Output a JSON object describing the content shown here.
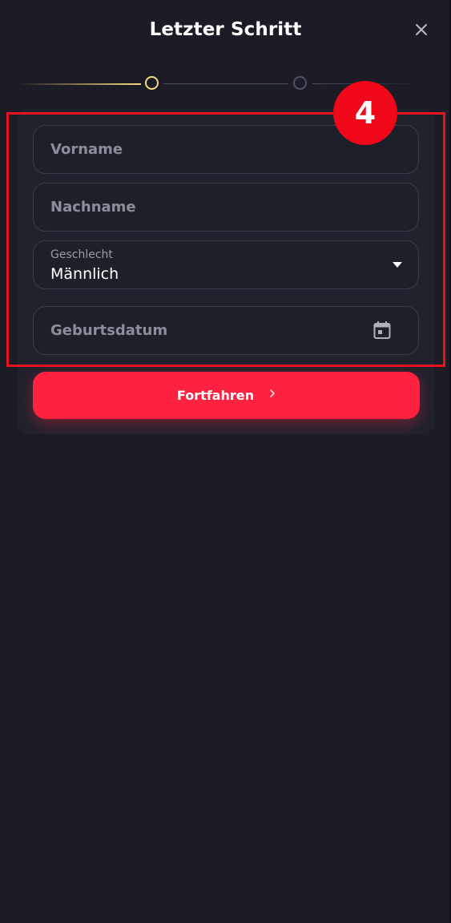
{
  "header": {
    "title": "Letzter Schritt",
    "close_icon": "close-icon"
  },
  "stepper": {
    "current_step": 1,
    "total_steps": 2,
    "active_color": "#f5d97e"
  },
  "form": {
    "first_name": {
      "placeholder": "Vorname",
      "value": ""
    },
    "last_name": {
      "placeholder": "Nachname",
      "value": ""
    },
    "gender": {
      "label": "Geschlecht",
      "value": "Männlich",
      "icon": "caret-down-icon"
    },
    "birthdate": {
      "placeholder": "Geburtsdatum",
      "value": "",
      "icon": "calendar-icon"
    }
  },
  "actions": {
    "continue_label": "Fortfahren",
    "continue_color": "#ff2240",
    "continue_icon": "chevron-right-icon"
  },
  "annotation": {
    "number": "4",
    "color": "#e8121f"
  }
}
